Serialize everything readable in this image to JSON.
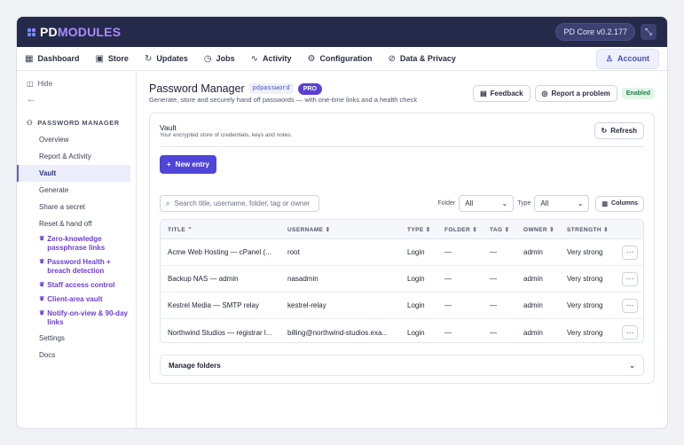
{
  "topbar": {
    "logo_a": "PD",
    "logo_b": "MODULES",
    "version": "PD Core v0.2.177"
  },
  "nav": {
    "items": [
      {
        "label": "Dashboard",
        "icon": "grid-icon"
      },
      {
        "label": "Store",
        "icon": "store-icon"
      },
      {
        "label": "Updates",
        "icon": "refresh-icon"
      },
      {
        "label": "Jobs",
        "icon": "clock-icon"
      },
      {
        "label": "Activity",
        "icon": "activity-icon"
      },
      {
        "label": "Configuration",
        "icon": "gear-icon"
      },
      {
        "label": "Data & Privacy",
        "icon": "shield-check-icon"
      }
    ],
    "account": "Account"
  },
  "sidebar": {
    "hide": "Hide",
    "back": "←",
    "section": "PASSWORD MANAGER",
    "items": [
      {
        "label": "Overview"
      },
      {
        "label": "Report & Activity"
      },
      {
        "label": "Vault",
        "active": true
      },
      {
        "label": "Generate"
      },
      {
        "label": "Share a secret"
      },
      {
        "label": "Reset & hand off"
      },
      {
        "label": "Zero-knowledge passphrase links",
        "pro": true
      },
      {
        "label": "Password Health + breach detection",
        "pro": true
      },
      {
        "label": "Staff access control",
        "pro": true
      },
      {
        "label": "Client-area vault",
        "pro": true
      },
      {
        "label": "Notify-on-view & 90-day links",
        "pro": true
      },
      {
        "label": "Settings"
      },
      {
        "label": "Docs"
      }
    ]
  },
  "header": {
    "title": "Password Manager",
    "code": "pdpassword",
    "pro": "PRO",
    "subtitle": "Generate, store and securely hand off passwords — with one-time links and a health check",
    "feedback": "Feedback",
    "report": "Report a problem",
    "health": "Enabled"
  },
  "vault": {
    "title": "Vault",
    "subtitle": "Your encrypted store of credentials, keys and notes.",
    "refresh": "Refresh",
    "new_entry": "New entry",
    "search_placeholder": "Search title, username, folder, tag or owner",
    "folder_label": "Folder",
    "folder_value": "All",
    "type_label": "Type",
    "type_value": "All",
    "columns": "Columns",
    "headers": [
      "TITLE",
      "USERNAME",
      "TYPE",
      "FOLDER",
      "TAG",
      "OWNER",
      "STRENGTH"
    ],
    "rows": [
      {
        "title": "Acme Web Hosting — cPanel (...",
        "username": "root",
        "type": "Login",
        "folder": "—",
        "tag": "—",
        "owner": "admin",
        "strength": "Very strong"
      },
      {
        "title": "Backup NAS — admin",
        "username": "nasadmin",
        "type": "Login",
        "folder": "—",
        "tag": "—",
        "owner": "admin",
        "strength": "Very strong"
      },
      {
        "title": "Kestrel Media — SMTP relay",
        "username": "kestrel-relay",
        "type": "Login",
        "folder": "—",
        "tag": "—",
        "owner": "admin",
        "strength": "Very strong"
      },
      {
        "title": "Northwind Studios — registrar l...",
        "username": "billing@northwind-studios.exa...",
        "type": "Login",
        "folder": "—",
        "tag": "—",
        "owner": "admin",
        "strength": "Very strong"
      }
    ],
    "manage_folders": "Manage folders"
  }
}
